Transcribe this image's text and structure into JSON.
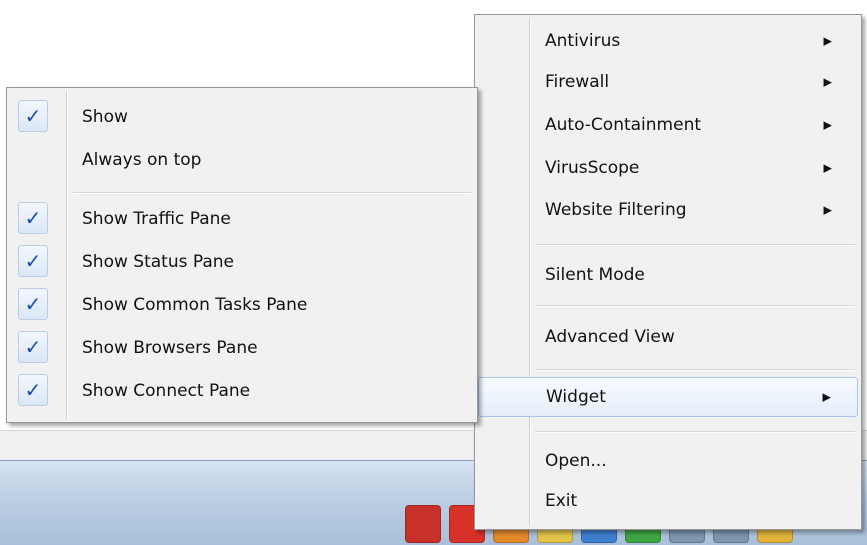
{
  "main_menu": {
    "items": [
      {
        "label": "Antivirus",
        "submenu": true
      },
      {
        "label": "Firewall",
        "submenu": true
      },
      {
        "label": "Auto-Containment",
        "submenu": true
      },
      {
        "label": "VirusScope",
        "submenu": true
      },
      {
        "label": "Website Filtering",
        "submenu": true
      },
      {
        "label": "Silent Mode",
        "submenu": false
      },
      {
        "label": "Advanced View",
        "submenu": false
      },
      {
        "label": "Widget",
        "submenu": true,
        "highlighted": true
      },
      {
        "label": "Open...",
        "submenu": false
      },
      {
        "label": "Exit",
        "submenu": false
      }
    ],
    "submenu_arrow": "▶"
  },
  "widget_submenu": {
    "items": [
      {
        "label": "Show",
        "checked": true
      },
      {
        "label": "Always on top",
        "checked": false
      },
      {
        "label": "Show Traffic Pane",
        "checked": true
      },
      {
        "label": "Show Status Pane",
        "checked": true
      },
      {
        "label": "Show Common Tasks Pane",
        "checked": true
      },
      {
        "label": "Show Browsers Pane",
        "checked": true
      },
      {
        "label": "Show Connect Pane",
        "checked": true
      }
    ],
    "check_glyph": "✓"
  },
  "taskbar": {
    "tray_icons": [
      {
        "name": "comodo-tray-icon",
        "color": "#c8312a"
      },
      {
        "name": "red-app-tray-icon",
        "color": "#d8312a"
      },
      {
        "name": "orange-app-tray-icon",
        "color": "#e58a2b"
      },
      {
        "name": "yellow-app-tray-icon",
        "color": "#e3c44a"
      },
      {
        "name": "blue-app-tray-icon",
        "color": "#3f7fd0"
      },
      {
        "name": "green-check-tray-icon",
        "color": "#3ea543"
      },
      {
        "name": "speaker-tray-icon",
        "color": "#7f95b0"
      },
      {
        "name": "network-tray-icon",
        "color": "#7f95b0"
      },
      {
        "name": "flag-tray-icon",
        "color": "#e2b33b"
      }
    ]
  },
  "colors": {
    "menu_bg": "#f1f1f1",
    "highlight_border": "#a9c6e8",
    "check_color": "#1e4fa8"
  }
}
